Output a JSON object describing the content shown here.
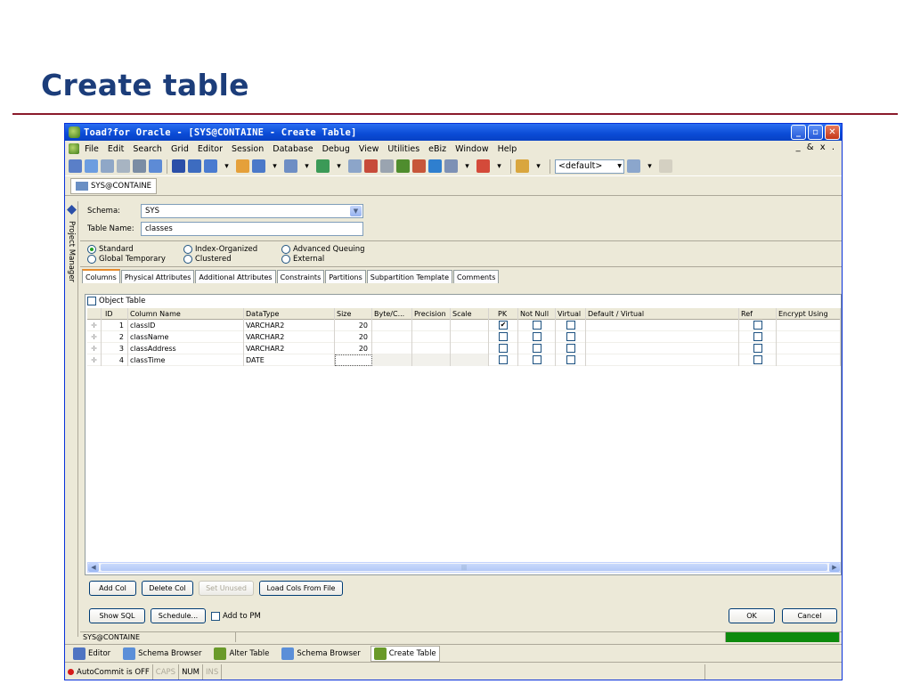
{
  "slide_title": "Create table",
  "window": {
    "title": "Toad?for Oracle - [SYS@CONTAINE - Create Table]",
    "buttons": {
      "minimize": "_",
      "maximize": "▫",
      "close": "✕"
    }
  },
  "menubar": {
    "items": [
      "File",
      "Edit",
      "Search",
      "Grid",
      "Editor",
      "Session",
      "Database",
      "Debug",
      "View",
      "Utilities",
      "eBiz",
      "Window",
      "Help"
    ],
    "right_controls": "_ & x ."
  },
  "toolbar": {
    "schema_combo_value": "<default>"
  },
  "connection_tab": "SYS@CONTAINE",
  "sidebar": {
    "label": "Project Manager"
  },
  "form": {
    "schema_label": "Schema:",
    "schema_value": "SYS",
    "table_name_label": "Table Name:",
    "table_name_value": "classes",
    "table_types": [
      {
        "label": "Standard",
        "checked": true
      },
      {
        "label": "Index-Organized",
        "checked": false
      },
      {
        "label": "Advanced Queuing",
        "checked": false
      },
      {
        "label": "Global Temporary",
        "checked": false
      },
      {
        "label": "Clustered",
        "checked": false
      },
      {
        "label": "External",
        "checked": false
      }
    ]
  },
  "tabs": [
    "Columns",
    "Physical Attributes",
    "Additional Attributes",
    "Constraints",
    "Partitions",
    "Subpartition Template",
    "Comments"
  ],
  "columns_tab": {
    "object_table_label": "Object Table",
    "headers": [
      "ID",
      "Column Name",
      "DataType",
      "Size",
      "Byte/C...",
      "Precision",
      "Scale",
      "PK",
      "Not Null",
      "Virtual",
      "Default / Virtual",
      "Ref",
      "Encrypt Using"
    ],
    "rows": [
      {
        "id": "1",
        "name": "classID",
        "datatype": "VARCHAR2",
        "size": "20",
        "pk": true
      },
      {
        "id": "2",
        "name": "className",
        "datatype": "VARCHAR2",
        "size": "20",
        "pk": false
      },
      {
        "id": "3",
        "name": "classAddress",
        "datatype": "VARCHAR2",
        "size": "20",
        "pk": false
      },
      {
        "id": "4",
        "name": "classTime",
        "datatype": "DATE",
        "size": "",
        "pk": false
      }
    ],
    "buttons": {
      "add_col": "Add Col",
      "delete_col": "Delete Col",
      "set_unused": "Set Unused",
      "load_cols": "Load Cols From File"
    }
  },
  "footer": {
    "show_sql": "Show SQL",
    "schedule": "Schedule...",
    "add_to_pm": "Add to PM",
    "ok": "OK",
    "cancel": "Cancel"
  },
  "statusbar": {
    "connection": "SYS@CONTAINE"
  },
  "taskbar": {
    "items": [
      {
        "label": "Editor",
        "active": false
      },
      {
        "label": "Schema Browser",
        "active": false
      },
      {
        "label": "Alter Table",
        "active": false
      },
      {
        "label": "Schema Browser",
        "active": false
      },
      {
        "label": "Create Table",
        "active": true
      }
    ]
  },
  "bottombar": {
    "autocommit": "AutoCommit is OFF",
    "caps": "CAPS",
    "num": "NUM",
    "ins": "INS"
  },
  "colors": {
    "title_blue": "#1c3d7a",
    "rule_red": "#8b1a2b",
    "xp_blue": "#0a4bd6",
    "status_green": "#0d8a0d"
  }
}
